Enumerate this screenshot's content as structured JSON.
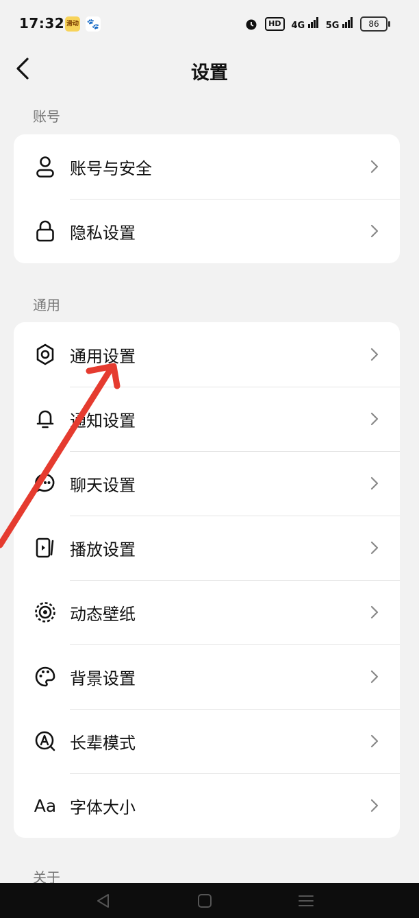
{
  "status_bar": {
    "time": "17:32",
    "badge_1": "滑动",
    "badge_2": "🐾",
    "hd_label": "HD",
    "net_1": "4G",
    "net_2": "5G",
    "battery": "86"
  },
  "header": {
    "title": "设置"
  },
  "sections": [
    {
      "label": "账号",
      "items": [
        {
          "label": "账号与安全",
          "icon": "person-icon"
        },
        {
          "label": "隐私设置",
          "icon": "lock-icon"
        }
      ]
    },
    {
      "label": "通用",
      "items": [
        {
          "label": "通用设置",
          "icon": "gear-icon"
        },
        {
          "label": "通知设置",
          "icon": "bell-icon"
        },
        {
          "label": "聊天设置",
          "icon": "chat-icon"
        },
        {
          "label": "播放设置",
          "icon": "play-icon"
        },
        {
          "label": "动态壁纸",
          "icon": "wallpaper-icon"
        },
        {
          "label": "背景设置",
          "icon": "palette-icon"
        },
        {
          "label": "长辈模式",
          "icon": "elder-mode-icon"
        },
        {
          "label": "字体大小",
          "icon": "font-size-icon"
        }
      ]
    },
    {
      "label": "关于"
    }
  ],
  "icons": {
    "font_size_glyph": "Aa"
  },
  "colors": {
    "annotation_arrow": "#e53b2f",
    "background": "#f2f2f2"
  }
}
